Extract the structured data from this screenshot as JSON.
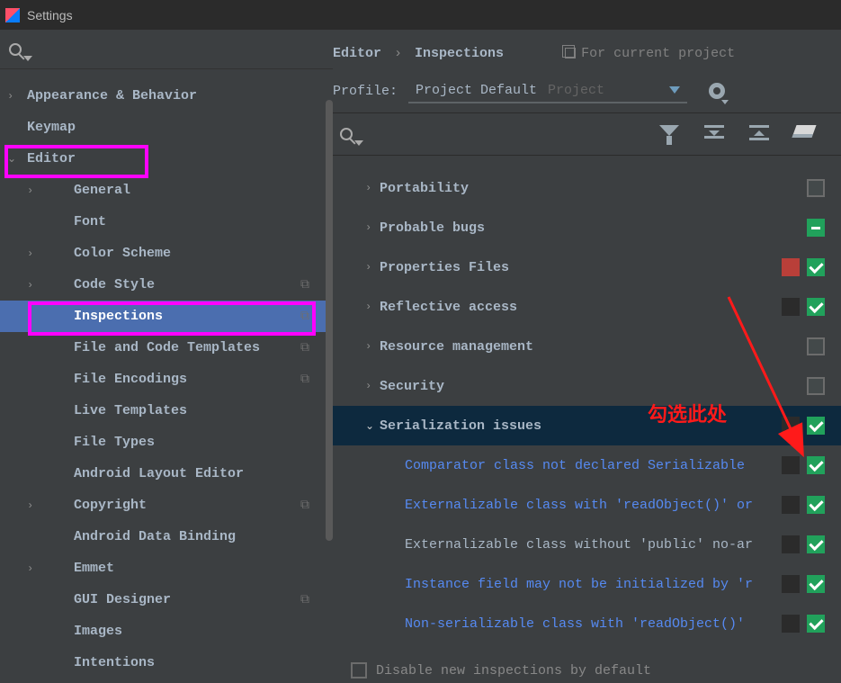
{
  "window": {
    "title": "Settings"
  },
  "sidebar": {
    "items": [
      {
        "label": "Appearance & Behavior",
        "exp": "›",
        "level": 0
      },
      {
        "label": "Keymap",
        "exp": "",
        "level": 0
      },
      {
        "label": "Editor",
        "exp": "⌄",
        "level": 0
      },
      {
        "label": "General",
        "exp": "›",
        "level": 1
      },
      {
        "label": "Font",
        "exp": "",
        "level": 1
      },
      {
        "label": "Color Scheme",
        "exp": "›",
        "level": 1
      },
      {
        "label": "Code Style",
        "exp": "›",
        "level": 1,
        "copy": true
      },
      {
        "label": "Inspections",
        "exp": "",
        "level": 1,
        "selected": true,
        "copy": true
      },
      {
        "label": "File and Code Templates",
        "exp": "",
        "level": 1,
        "copy": true
      },
      {
        "label": "File Encodings",
        "exp": "",
        "level": 1,
        "copy": true
      },
      {
        "label": "Live Templates",
        "exp": "",
        "level": 1
      },
      {
        "label": "File Types",
        "exp": "",
        "level": 1
      },
      {
        "label": "Android Layout Editor",
        "exp": "",
        "level": 1
      },
      {
        "label": "Copyright",
        "exp": "›",
        "level": 1,
        "copy": true
      },
      {
        "label": "Android Data Binding",
        "exp": "",
        "level": 1
      },
      {
        "label": "Emmet",
        "exp": "›",
        "level": 1
      },
      {
        "label": "GUI Designer",
        "exp": "",
        "level": 1,
        "copy": true
      },
      {
        "label": "Images",
        "exp": "",
        "level": 1
      },
      {
        "label": "Intentions",
        "exp": "",
        "level": 1
      }
    ]
  },
  "breadcrumb": {
    "a": "Editor",
    "b": "Inspections",
    "sep": "›"
  },
  "scope_chip": "For current project",
  "profile": {
    "label": "Profile:",
    "value": "Project Default",
    "context": "Project"
  },
  "categories": [
    {
      "label": "Portability",
      "exp": "›",
      "check": "off"
    },
    {
      "label": "Probable bugs",
      "exp": "›",
      "check": "mixed"
    },
    {
      "label": "Properties Files",
      "exp": "›",
      "sev": "red",
      "check": "on"
    },
    {
      "label": "Reflective access",
      "exp": "›",
      "sev": "dark",
      "check": "on"
    },
    {
      "label": "Resource management",
      "exp": "›",
      "check": "off"
    },
    {
      "label": "Security",
      "exp": "›",
      "check": "off"
    },
    {
      "label": "Serialization issues",
      "exp": "⌄",
      "sev": "dark",
      "check": "on",
      "selected": true
    }
  ],
  "leaves": [
    {
      "label": "Comparator class not declared Serializable",
      "link": true,
      "sev": "dark",
      "check": "on"
    },
    {
      "label": "Externalizable class with 'readObject()' or",
      "link": true,
      "sev": "dark",
      "check": "on"
    },
    {
      "label": "Externalizable class without 'public' no-ar",
      "link": false,
      "sev": "dark",
      "check": "on"
    },
    {
      "label": "Instance field may not be initialized by 'r",
      "link": true,
      "sev": "dark",
      "check": "on"
    },
    {
      "label": "Non-serializable class with 'readObject()'",
      "link": true,
      "sev": "dark",
      "check": "on"
    }
  ],
  "annotation": "勾选此处",
  "footer": {
    "label": "Disable new inspections by default"
  }
}
